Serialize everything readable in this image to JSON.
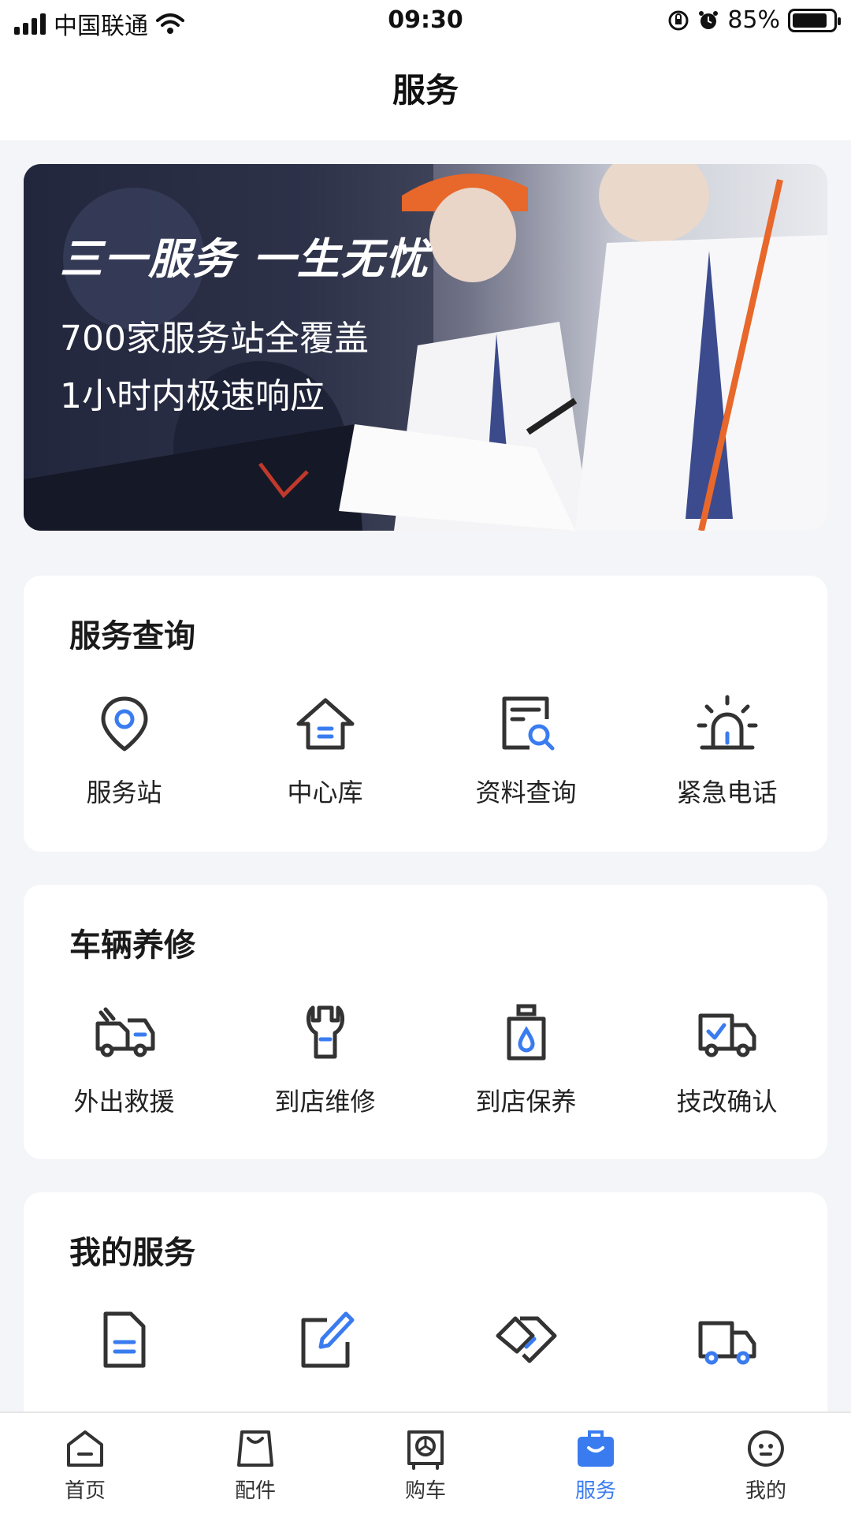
{
  "status_bar": {
    "carrier": "中国联通",
    "time": "09:30",
    "battery": "85%",
    "battery_level": 0.85
  },
  "nav": {
    "title": "服务"
  },
  "banner": {
    "slogan": "三一服务 一生无忧",
    "line1": "700家服务站全覆盖",
    "line2": "1小时内极速响应"
  },
  "sections": [
    {
      "title": "服务查询",
      "items": [
        {
          "label": "服务站",
          "icon": "location-pin-icon"
        },
        {
          "label": "中心库",
          "icon": "warehouse-icon"
        },
        {
          "label": "资料查询",
          "icon": "document-search-icon"
        },
        {
          "label": "紧急电话",
          "icon": "alarm-light-icon"
        }
      ]
    },
    {
      "title": "车辆养修",
      "items": [
        {
          "label": "外出救援",
          "icon": "rescue-truck-icon"
        },
        {
          "label": "到店维修",
          "icon": "wrench-icon"
        },
        {
          "label": "到店保养",
          "icon": "oil-can-icon"
        },
        {
          "label": "技改确认",
          "icon": "truck-check-icon"
        }
      ]
    },
    {
      "title": "我的服务",
      "items": [
        {
          "label": "",
          "icon": "document-icon"
        },
        {
          "label": "",
          "icon": "edit-icon"
        },
        {
          "label": "",
          "icon": "handshake-icon"
        },
        {
          "label": "",
          "icon": "truck-icon"
        }
      ]
    }
  ],
  "tabs": [
    {
      "label": "首页",
      "icon": "home-icon"
    },
    {
      "label": "配件",
      "icon": "bag-icon"
    },
    {
      "label": "购车",
      "icon": "truck-front-icon"
    },
    {
      "label": "服务",
      "icon": "service-bag-icon"
    },
    {
      "label": "我的",
      "icon": "profile-icon"
    }
  ],
  "colors": {
    "accent": "#3a7cf0",
    "icon_stroke": "#333333",
    "background": "#f4f5f8"
  }
}
